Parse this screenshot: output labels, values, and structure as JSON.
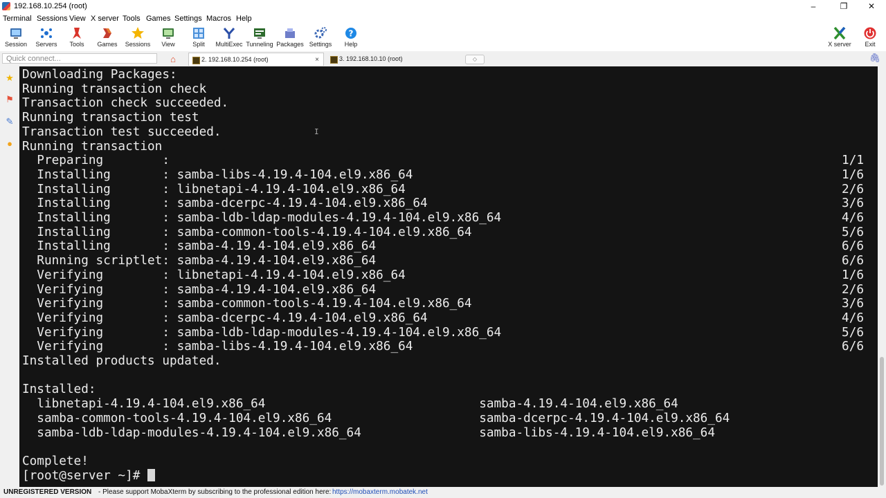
{
  "window": {
    "title": "192.168.10.254 (root)",
    "minimize": "–",
    "maximize": "❐",
    "close": "✕"
  },
  "menu": [
    "Terminal",
    "Sessions",
    "View",
    "X server",
    "Tools",
    "Games",
    "Settings",
    "Macros",
    "Help"
  ],
  "toolbar": {
    "session": "Session",
    "servers": "Servers",
    "tools": "Tools",
    "games": "Games",
    "sessions": "Sessions",
    "view": "View",
    "split": "Split",
    "multiexec": "MultiExec",
    "tunneling": "Tunneling",
    "packages": "Packages",
    "settings": "Settings",
    "help": "Help",
    "xserver": "X server",
    "exit": "Exit"
  },
  "tabs": {
    "quick_connect_placeholder": "Quick connect...",
    "home_glyph": "⌂",
    "tab1_label": "2. 192.168.10.254 (root)",
    "tab2_label": "3. 192.168.10.10 (root)",
    "close_glyph": "×",
    "attach_glyph": "🖇"
  },
  "terminal": {
    "lines": [
      "Downloading Packages:",
      "Running transaction check",
      "Transaction check succeeded.",
      "Running transaction test",
      "Transaction test succeeded.",
      "Running transaction",
      "  Preparing        :",
      "  Installing       : samba-libs-4.19.4-104.el9.x86_64",
      "  Installing       : libnetapi-4.19.4-104.el9.x86_64",
      "  Installing       : samba-dcerpc-4.19.4-104.el9.x86_64",
      "  Installing       : samba-ldb-ldap-modules-4.19.4-104.el9.x86_64",
      "  Installing       : samba-common-tools-4.19.4-104.el9.x86_64",
      "  Installing       : samba-4.19.4-104.el9.x86_64",
      "  Running scriptlet: samba-4.19.4-104.el9.x86_64",
      "  Verifying        : libnetapi-4.19.4-104.el9.x86_64",
      "  Verifying        : samba-4.19.4-104.el9.x86_64",
      "  Verifying        : samba-common-tools-4.19.4-104.el9.x86_64",
      "  Verifying        : samba-dcerpc-4.19.4-104.el9.x86_64",
      "  Verifying        : samba-ldb-ldap-modules-4.19.4-104.el9.x86_64",
      "  Verifying        : samba-libs-4.19.4-104.el9.x86_64",
      "Installed products updated.",
      "",
      "Installed:",
      "  libnetapi-4.19.4-104.el9.x86_64                             samba-4.19.4-104.el9.x86_64",
      "  samba-common-tools-4.19.4-104.el9.x86_64                    samba-dcerpc-4.19.4-104.el9.x86_64",
      "  samba-ldb-ldap-modules-4.19.4-104.el9.x86_64                samba-libs-4.19.4-104.el9.x86_64",
      "",
      "Complete!"
    ],
    "progress": [
      "",
      "",
      "",
      "",
      "",
      "",
      "1/1",
      "1/6",
      "2/6",
      "3/6",
      "4/6",
      "5/6",
      "6/6",
      "6/6",
      "1/6",
      "2/6",
      "3/6",
      "4/6",
      "5/6",
      "6/6"
    ],
    "prompt": "[root@server ~]# "
  },
  "status": {
    "unregistered": "UNREGISTERED VERSION",
    "message": "-  Please support MobaXterm by subscribing to the professional edition here:",
    "link": "https://mobaxterm.mobatek.net"
  }
}
